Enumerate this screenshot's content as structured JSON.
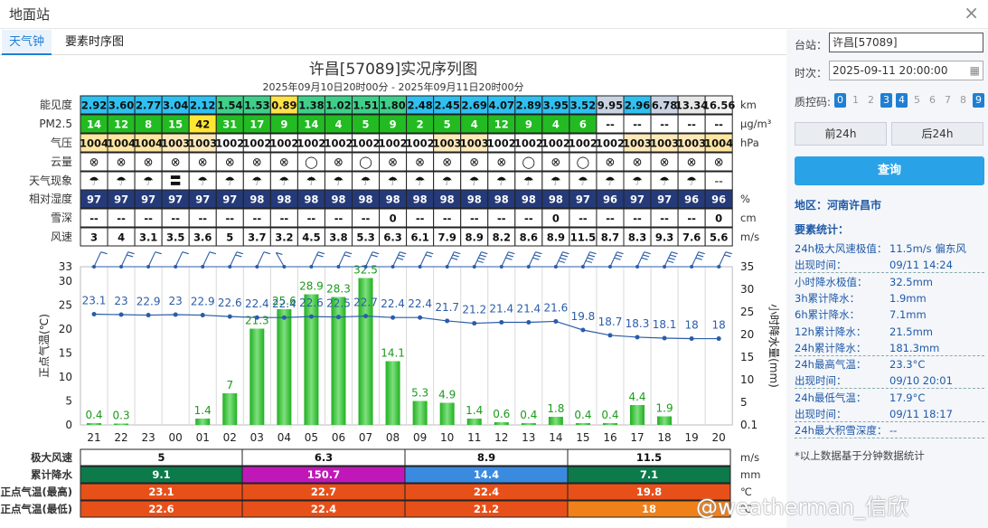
{
  "window": {
    "title": "地面站"
  },
  "tabs": [
    {
      "label": "天气钟",
      "active": true
    },
    {
      "label": "要素时序图",
      "active": false
    }
  ],
  "chart_data": {
    "type": "bar",
    "title": "许昌[57089]实况序列图",
    "subtitle": "2025年09月10日20时00分 - 2025年09月11日20时00分",
    "x": [
      "21",
      "22",
      "23",
      "00",
      "01",
      "02",
      "03",
      "04",
      "05",
      "06",
      "07",
      "08",
      "09",
      "10",
      "11",
      "12",
      "13",
      "14",
      "15",
      "16",
      "17",
      "18",
      "19",
      "20"
    ],
    "rows": [
      {
        "label": "能见度",
        "unit": "km",
        "values": [
          "2.92",
          "3.60",
          "2.77",
          "3.04",
          "2.12",
          "1.54",
          "1.53",
          "0.89",
          "1.38",
          "1.02",
          "1.51",
          "1.80",
          "2.48",
          "2.45",
          "2.69",
          "4.07",
          "2.89",
          "3.95",
          "3.52",
          "9.95",
          "2.96",
          "6.78",
          "13.34",
          "16.56"
        ]
      },
      {
        "label": "PM2.5",
        "unit": "μg/m³",
        "values": [
          "14",
          "12",
          "8",
          "15",
          "42",
          "31",
          "17",
          "9",
          "14",
          "4",
          "5",
          "9",
          "2",
          "5",
          "4",
          "12",
          "9",
          "4",
          "6",
          "--",
          "--",
          "--",
          "--",
          "--"
        ]
      },
      {
        "label": "气压",
        "unit": "hPa",
        "values": [
          "1004",
          "1004",
          "1004",
          "1003",
          "1003",
          "1002",
          "1002",
          "1002",
          "1002",
          "1002",
          "1002",
          "1002",
          "1002",
          "1003",
          "1003",
          "1002",
          "1002",
          "1002",
          "1002",
          "1002",
          "1003",
          "1003",
          "1003",
          "1004"
        ]
      },
      {
        "label": "云量",
        "unit": "",
        "values": [
          "⊗",
          "⊗",
          "⊗",
          "⊗",
          "⊗",
          "⊗",
          "⊗",
          "⊗",
          "◯",
          "⊗",
          "◯",
          "⊗",
          "⊗",
          "⊗",
          "⊗",
          "⊗",
          "◯",
          "⊗",
          "◯",
          "⊗",
          "⊗",
          "⊗",
          "⊗",
          "⊗"
        ]
      },
      {
        "label": "天气现象",
        "unit": "",
        "values": [
          "☂",
          "☂",
          "☂",
          "〓",
          "☂",
          "☂",
          "☂",
          "☂",
          "☂",
          "☂",
          "☂",
          "☂",
          "☂",
          "☂",
          "☂",
          "☂",
          "☂",
          "☂",
          "☂",
          "☂",
          "☂",
          "☂",
          "☂",
          "--"
        ]
      },
      {
        "label": "相对湿度",
        "unit": "%",
        "values": [
          "97",
          "97",
          "97",
          "97",
          "97",
          "97",
          "98",
          "98",
          "98",
          "98",
          "98",
          "98",
          "98",
          "98",
          "98",
          "98",
          "98",
          "98",
          "97",
          "96",
          "97",
          "97",
          "96",
          "96"
        ]
      },
      {
        "label": "雪深",
        "unit": "cm",
        "values": [
          "--",
          "--",
          "--",
          "--",
          "--",
          "--",
          "--",
          "--",
          "--",
          "--",
          "--",
          "0",
          "--",
          "--",
          "--",
          "--",
          "--",
          "0",
          "--",
          "--",
          "--",
          "--",
          "--",
          "0"
        ]
      },
      {
        "label": "风速",
        "unit": "m/s",
        "values": [
          "3",
          "4",
          "3.1",
          "3.5",
          "3.6",
          "5",
          "3.7",
          "3.2",
          "4.5",
          "3.8",
          "5.3",
          "6.3",
          "6.1",
          "7.9",
          "8.9",
          "8.2",
          "8.6",
          "8.9",
          "11.5",
          "8.7",
          "8.3",
          "9.3",
          "7.6",
          "5.6"
        ]
      }
    ],
    "temperature": [
      23.1,
      23,
      22.9,
      23,
      22.9,
      22.6,
      22.4,
      22.4,
      22.6,
      22.5,
      22.7,
      22.4,
      22.4,
      21.7,
      21.2,
      21.4,
      21.4,
      21.6,
      19.8,
      18.7,
      18.3,
      18.1,
      18,
      18
    ],
    "temperature_labels": [
      "23.1",
      "23",
      "22.9",
      "23",
      "22.9",
      "22.6",
      "22.4",
      "22.4",
      "22.6",
      "22.5",
      "22.7",
      "22.4",
      "22.4",
      "21.7",
      "21.2",
      "21.4",
      "21.4",
      "21.6",
      "19.8",
      "18.7",
      "18.3",
      "18.1",
      "18",
      "18"
    ],
    "precipitation": [
      0.4,
      0.3,
      0,
      0,
      1.4,
      7,
      21.3,
      25.6,
      28.9,
      28.3,
      32.5,
      14.1,
      5.3,
      4.9,
      1.4,
      0.6,
      0.4,
      1.8,
      0.4,
      0.4,
      4.4,
      1.9,
      0,
      0
    ],
    "precipitation_labels": [
      "0.4",
      "0.3",
      "",
      "",
      "1.4",
      "7",
      "21.3",
      "25.6",
      "28.9",
      "28.3",
      "32.5",
      "14.1",
      "5.3",
      "4.9",
      "1.4",
      "0.6",
      "0.4",
      "1.8",
      "0.4",
      "0.4",
      "4.4",
      "1.9",
      "",
      ""
    ],
    "ylabel_left": "正点气温(℃)",
    "ylabel_right": "小时降水量(mm)",
    "left_ticks": [
      "33",
      "30",
      "25",
      "20",
      "15",
      "10",
      "5",
      "0"
    ],
    "right_ticks": [
      "35",
      "30",
      "25",
      "20",
      "15",
      "10",
      "5",
      "0.1"
    ],
    "summary": [
      {
        "label": "极大风速",
        "unit": "m/s",
        "values": [
          "5",
          "6.3",
          "8.9",
          "11.5"
        ],
        "colors": [
          "#ffffff",
          "#ffffff",
          "#ffffff",
          "#ffffff"
        ]
      },
      {
        "label": "累计降水",
        "unit": "mm",
        "values": [
          "9.1",
          "150.7",
          "14.4",
          "7.1"
        ],
        "colors": [
          "#0c7a4a",
          "#c018b8",
          "#3a8ae0",
          "#0c7a4a"
        ]
      },
      {
        "label": "正点气温(最高)",
        "unit": "℃",
        "values": [
          "23.1",
          "22.7",
          "22.4",
          "19.8"
        ],
        "colors": [
          "#e8501a",
          "#e8501a",
          "#e8501a",
          "#e8501a"
        ]
      },
      {
        "label": "正点气温(最低)",
        "unit": "℃",
        "values": [
          "22.6",
          "22.4",
          "21.2",
          "18"
        ],
        "colors": [
          "#e8501a",
          "#e8501a",
          "#e8501a",
          "#f0801a"
        ]
      }
    ]
  },
  "panel": {
    "station_label": "台站：",
    "station_value": "许昌[57089]",
    "time_label": "时次：",
    "time_value": "2025-09-11 20:00:00",
    "qc_label": "质控码:",
    "qc_codes": [
      "0",
      "1",
      "2",
      "3",
      "4",
      "5",
      "6",
      "7",
      "8",
      "9"
    ],
    "qc_active": [
      "0",
      "3",
      "4",
      "9"
    ],
    "prev_label": "前24h",
    "next_label": "后24h",
    "query_label": "查询",
    "region": "地区：河南许昌市",
    "stats_title": "要素统计：",
    "stats": [
      {
        "k": "24h极大风速极值：",
        "v": "11.5m/s 偏东风",
        "dash": false
      },
      {
        "k": "出现时间：",
        "v": "09/11 14:24",
        "dash": true
      },
      {
        "k": "小时降水极值：",
        "v": "32.5mm",
        "dash": false
      },
      {
        "k": "3h累计降水：",
        "v": "1.9mm",
        "dash": false
      },
      {
        "k": "6h累计降水：",
        "v": "7.1mm",
        "dash": false
      },
      {
        "k": "12h累计降水：",
        "v": "21.5mm",
        "dash": false
      },
      {
        "k": "24h累计降水：",
        "v": "181.3mm",
        "dash": true
      },
      {
        "k": "24h最高气温：",
        "v": "23.3°C",
        "dash": false
      },
      {
        "k": "出现时间：",
        "v": "09/10 20:01",
        "dash": true
      },
      {
        "k": "24h最低气温：",
        "v": "17.9°C",
        "dash": false
      },
      {
        "k": "出现时间：",
        "v": "09/11 18:17",
        "dash": true
      },
      {
        "k": "24h最大积雪深度：",
        "v": "--",
        "dash": true
      }
    ],
    "note": "*以上数据基于分钟数据统计"
  },
  "watermark": "@weatherman_信欣"
}
